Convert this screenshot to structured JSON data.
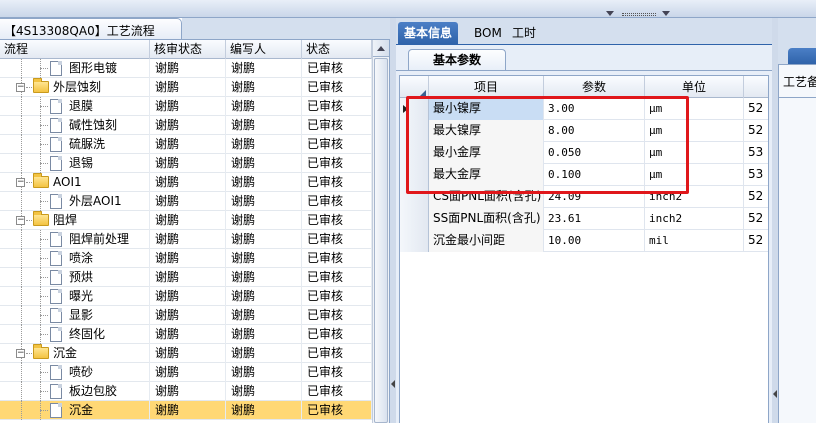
{
  "left_panel": {
    "header_tab": "【4S13308QA0】工艺流程",
    "columns": [
      "流程",
      "核审状态",
      "编写人",
      "状态"
    ],
    "rows": [
      {
        "indent": 2,
        "kind": "doc",
        "label": "图形电镀",
        "reviewer": "谢鹏",
        "writer": "谢鹏",
        "status": "已审核"
      },
      {
        "indent": 1,
        "kind": "folder",
        "label": "外层蚀刻",
        "reviewer": "谢鹏",
        "writer": "谢鹏",
        "status": "已审核"
      },
      {
        "indent": 2,
        "kind": "doc",
        "label": "退膜",
        "reviewer": "谢鹏",
        "writer": "谢鹏",
        "status": "已审核"
      },
      {
        "indent": 2,
        "kind": "doc",
        "label": "碱性蚀刻",
        "reviewer": "谢鹏",
        "writer": "谢鹏",
        "status": "已审核"
      },
      {
        "indent": 2,
        "kind": "doc",
        "label": "硫脲洗",
        "reviewer": "谢鹏",
        "writer": "谢鹏",
        "status": "已审核"
      },
      {
        "indent": 2,
        "kind": "doc",
        "label": "退锡",
        "reviewer": "谢鹏",
        "writer": "谢鹏",
        "status": "已审核"
      },
      {
        "indent": 1,
        "kind": "folder",
        "label": "AOI1",
        "reviewer": "谢鹏",
        "writer": "谢鹏",
        "status": "已审核"
      },
      {
        "indent": 2,
        "kind": "doc",
        "label": "外层AOI1",
        "reviewer": "谢鹏",
        "writer": "谢鹏",
        "status": "已审核"
      },
      {
        "indent": 1,
        "kind": "folder",
        "label": "阻焊",
        "reviewer": "谢鹏",
        "writer": "谢鹏",
        "status": "已审核"
      },
      {
        "indent": 2,
        "kind": "doc",
        "label": "阻焊前处理",
        "reviewer": "谢鹏",
        "writer": "谢鹏",
        "status": "已审核"
      },
      {
        "indent": 2,
        "kind": "doc",
        "label": "喷涂",
        "reviewer": "谢鹏",
        "writer": "谢鹏",
        "status": "已审核"
      },
      {
        "indent": 2,
        "kind": "doc",
        "label": "预烘",
        "reviewer": "谢鹏",
        "writer": "谢鹏",
        "status": "已审核"
      },
      {
        "indent": 2,
        "kind": "doc",
        "label": "曝光",
        "reviewer": "谢鹏",
        "writer": "谢鹏",
        "status": "已审核"
      },
      {
        "indent": 2,
        "kind": "doc",
        "label": "显影",
        "reviewer": "谢鹏",
        "writer": "谢鹏",
        "status": "已审核"
      },
      {
        "indent": 2,
        "kind": "doc",
        "label": "终固化",
        "reviewer": "谢鹏",
        "writer": "谢鹏",
        "status": "已审核"
      },
      {
        "indent": 1,
        "kind": "folder",
        "label": "沉金",
        "reviewer": "谢鹏",
        "writer": "谢鹏",
        "status": "已审核"
      },
      {
        "indent": 2,
        "kind": "doc",
        "label": "喷砂",
        "reviewer": "谢鹏",
        "writer": "谢鹏",
        "status": "已审核"
      },
      {
        "indent": 2,
        "kind": "doc",
        "label": "板边包胶",
        "reviewer": "谢鹏",
        "writer": "谢鹏",
        "status": "已审核"
      },
      {
        "indent": 2,
        "kind": "doc",
        "label": "沉金",
        "reviewer": "谢鹏",
        "writer": "谢鹏",
        "status": "已审核",
        "selected": true
      }
    ]
  },
  "middle_panel": {
    "tabs": [
      "基本信息",
      "BOM",
      "工时"
    ],
    "active_tab": "基本信息",
    "subtab": "基本参数",
    "columns": [
      "项目",
      "参数",
      "单位"
    ],
    "rows": [
      {
        "item": "最小镍厚",
        "value": "3.00",
        "unit": "μm",
        "extra": "52"
      },
      {
        "item": "最大镍厚",
        "value": "8.00",
        "unit": "μm",
        "extra": "52"
      },
      {
        "item": "最小金厚",
        "value": "0.050",
        "unit": "μm",
        "extra": "53"
      },
      {
        "item": "最大金厚",
        "value": "0.100",
        "unit": "μm",
        "extra": "53"
      },
      {
        "item": "CS面PNL面积(含孔)",
        "value": "24.09",
        "unit": "inch2",
        "extra": "52"
      },
      {
        "item": "SS面PNL面积(含孔)",
        "value": "23.61",
        "unit": "inch2",
        "extra": "52"
      },
      {
        "item": "沉金最小间距",
        "value": "10.00",
        "unit": "mil",
        "extra": "52"
      }
    ]
  },
  "right_panel": {
    "label": "工艺备"
  },
  "colors": {
    "selected_row": "#ffd875",
    "active_tab": "#2f63aa",
    "highlight_box": "#e0171b"
  }
}
